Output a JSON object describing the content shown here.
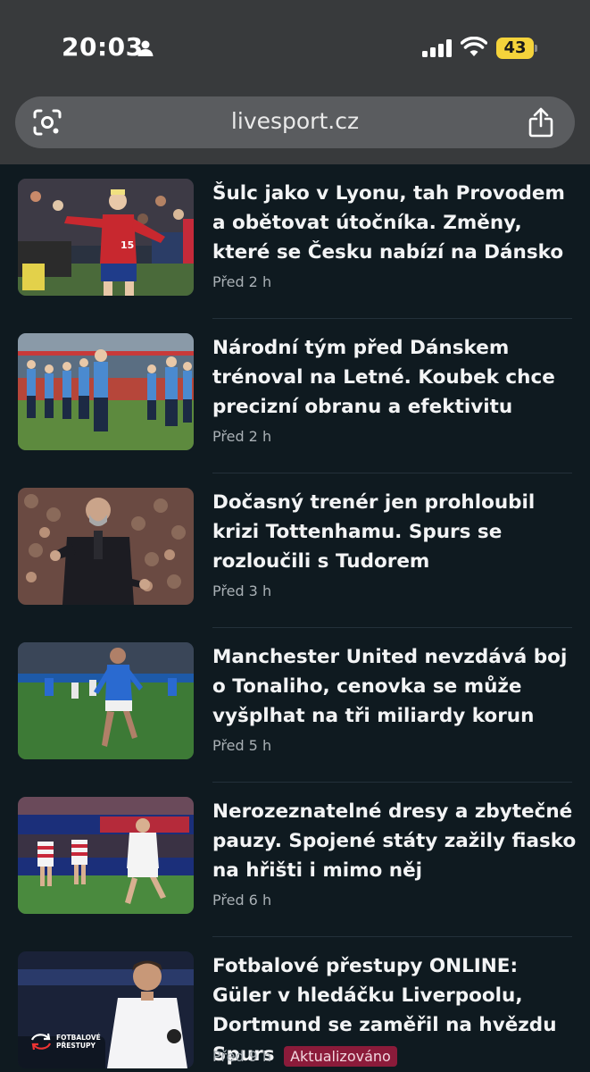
{
  "status_bar": {
    "time": "20:03",
    "battery": "43"
  },
  "browser": {
    "url": "livesport.cz"
  },
  "articles": [
    {
      "headline": "Šulc jako v Lyonu, tah Provodem a obětovat útočníka. Změny, které se Česku nabízí na Dánsko",
      "time": "Před 2 h"
    },
    {
      "headline": "Národní tým před Dánskem trénoval na Letné. Koubek chce precizní obranu a efektivitu",
      "time": "Před 2 h"
    },
    {
      "headline": "Dočasný trenér jen prohloubil krizi Tottenhamu. Spurs se rozloučili s Tudorem",
      "time": "Před 3 h"
    },
    {
      "headline": "Manchester United nevzdává boj o Tonaliho, cenovka se může vyšplhat na tři miliardy korun",
      "time": "Před 5 h"
    },
    {
      "headline": "Nerozeznatelné dresy a zbytečné pauzy. Spojené státy zažily fiasko na hřišti i mimo něj",
      "time": "Před 6 h"
    },
    {
      "headline": "Fotbalové přestupy ONLINE: Güler v hledáčku Liverpoolu, Dortmund se zaměřil na hvězdu Spurs",
      "time": "Před 9 h",
      "badge": "Aktualizováno",
      "thumb_logo": "FOTBALOVÉ PŘESTUPY"
    }
  ]
}
